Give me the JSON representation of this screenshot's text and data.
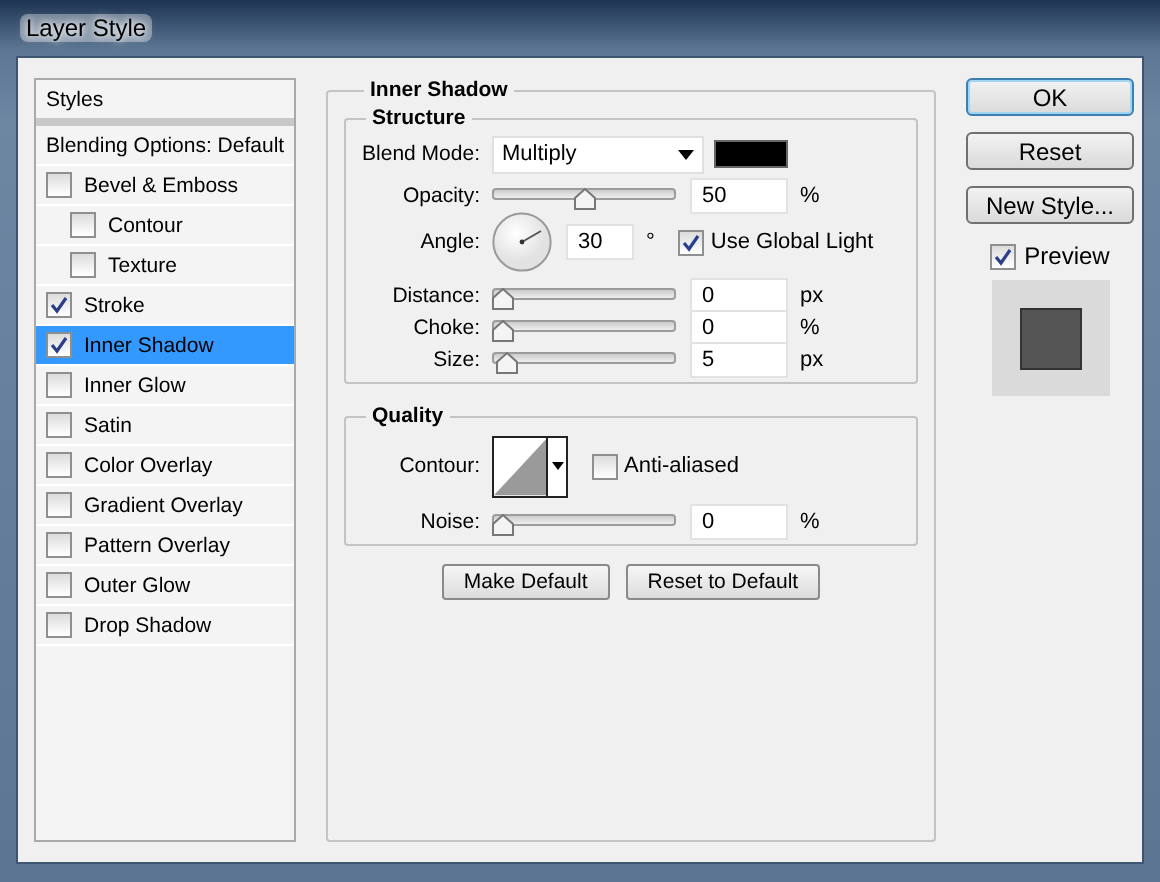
{
  "window": {
    "title": "Layer Style"
  },
  "styles_panel": {
    "header": "Styles",
    "items": [
      {
        "label": "Blending Options: Default",
        "kind": "plain",
        "selected": false
      },
      {
        "label": "Bevel & Emboss",
        "kind": "checkbox",
        "checked": false,
        "selected": false,
        "children": [
          {
            "label": "Contour",
            "kind": "checkbox",
            "checked": false,
            "selected": false
          },
          {
            "label": "Texture",
            "kind": "checkbox",
            "checked": false,
            "selected": false
          }
        ]
      },
      {
        "label": "Stroke",
        "kind": "checkbox",
        "checked": true,
        "selected": false
      },
      {
        "label": "Inner Shadow",
        "kind": "checkbox",
        "checked": true,
        "selected": true
      },
      {
        "label": "Inner Glow",
        "kind": "checkbox",
        "checked": false,
        "selected": false
      },
      {
        "label": "Satin",
        "kind": "checkbox",
        "checked": false,
        "selected": false
      },
      {
        "label": "Color Overlay",
        "kind": "checkbox",
        "checked": false,
        "selected": false
      },
      {
        "label": "Gradient Overlay",
        "kind": "checkbox",
        "checked": false,
        "selected": false
      },
      {
        "label": "Pattern Overlay",
        "kind": "checkbox",
        "checked": false,
        "selected": false
      },
      {
        "label": "Outer Glow",
        "kind": "checkbox",
        "checked": false,
        "selected": false
      },
      {
        "label": "Drop Shadow",
        "kind": "checkbox",
        "checked": false,
        "selected": false
      }
    ]
  },
  "effect": {
    "title": "Inner Shadow",
    "structure": {
      "title": "Structure",
      "rows": [
        {
          "kind": "select",
          "label": "Blend Mode:",
          "value": "Multiply",
          "color": "#000000"
        },
        {
          "kind": "slider",
          "label": "Opacity:",
          "level": 0.5,
          "value": "50",
          "unit": "%"
        },
        {
          "kind": "angle",
          "label": "Angle:",
          "value": "30",
          "unit": "°",
          "option": {
            "label": "Use Global Light",
            "checked": true
          }
        },
        {
          "kind": "slider",
          "label": "Distance:",
          "level": 0,
          "value": "0",
          "unit": "px"
        },
        {
          "kind": "slider",
          "label": "Choke:",
          "level": 0,
          "value": "0",
          "unit": "%"
        },
        {
          "kind": "slider",
          "label": "Size:",
          "level": 0.02,
          "value": "5",
          "unit": "px"
        }
      ]
    },
    "quality": {
      "title": "Quality",
      "rows": [
        {
          "kind": "contour",
          "label": "Contour:",
          "option": {
            "label": "Anti-aliased",
            "checked": false
          }
        },
        {
          "kind": "slider",
          "label": "Noise:",
          "level": 0,
          "value": "0",
          "unit": "%"
        }
      ]
    },
    "buttons": [
      "Make Default",
      "Reset to Default"
    ]
  },
  "actions": {
    "buttons": [
      {
        "label": "OK",
        "default": true
      },
      {
        "label": "Reset",
        "default": false
      },
      {
        "label": "New Style...",
        "default": false
      }
    ],
    "preview": {
      "label": "Preview",
      "checked": true
    }
  }
}
